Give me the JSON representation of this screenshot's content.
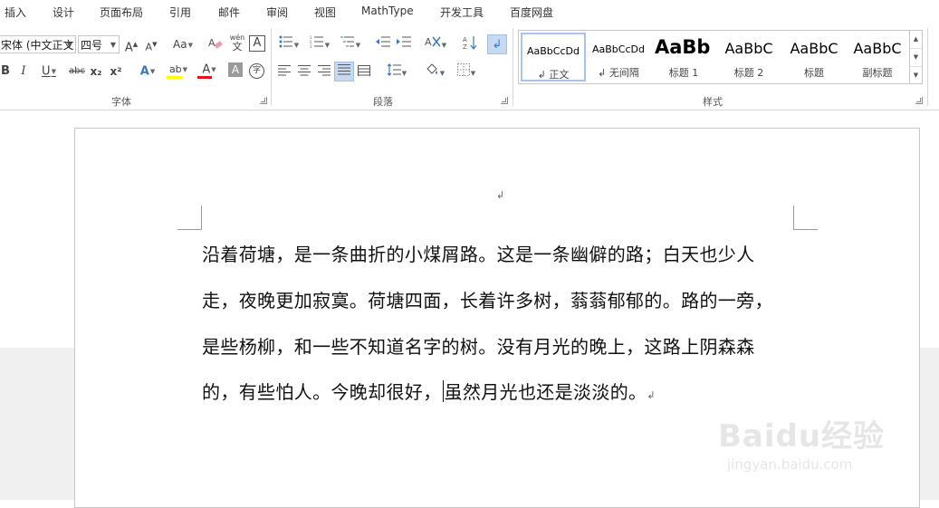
{
  "menu": {
    "tabs": [
      "插入",
      "设计",
      "页面布局",
      "引用",
      "邮件",
      "审阅",
      "视图",
      "MathType",
      "开发工具",
      "百度网盘"
    ]
  },
  "ribbon": {
    "font_group": {
      "label": "字体",
      "font_name": "宋体 (中文正文",
      "font_size": "四号",
      "grow_font": "A",
      "shrink_font": "A",
      "change_case": "Aa",
      "phonetic": "wén",
      "phonetic_char": "文",
      "char_border": "A",
      "bold": "B",
      "italic": "I",
      "underline": "U",
      "strikethrough": "abc",
      "subscript": "x₂",
      "superscript": "x²",
      "text_effects": "A",
      "highlight": "ab",
      "font_color": "A",
      "char_shading": "A",
      "enclose_char": "字",
      "highlight_color": "#ffff00",
      "font_color_value": "#e81123"
    },
    "paragraph_group": {
      "label": "段落"
    },
    "styles_group": {
      "label": "样式",
      "items": [
        {
          "sample": "AaBbCcDd",
          "name": "正文",
          "mark": "↲"
        },
        {
          "sample": "AaBbCcDd",
          "name": "无间隔",
          "mark": "↲"
        },
        {
          "sample": "AaBb",
          "name": "标题 1",
          "mark": ""
        },
        {
          "sample": "AaBbC",
          "name": "标题 2",
          "mark": ""
        },
        {
          "sample": "AaBbC",
          "name": "标题",
          "mark": ""
        },
        {
          "sample": "AaBbC",
          "name": "副标题",
          "mark": ""
        }
      ]
    }
  },
  "document": {
    "top_mark": "↲",
    "lines": [
      "沿着荷塘，是一条曲折的小煤屑路。这是一条幽僻的路；白天也少人",
      "走，夜晚更加寂寞。荷塘四面，长着许多树，蓊蓊郁郁的。路的一旁，",
      "是些杨柳，和一些不知道名字的树。没有月光的晚上，这路上阴森森"
    ],
    "last_line_before_cursor": "的，有些怕人。今晚却很好，",
    "last_line_after_cursor": "虽然月光也还是淡淡的。",
    "end_mark": "↲"
  },
  "watermark": {
    "main": "Baidu经验",
    "sub": "jingyan.baidu.com"
  }
}
